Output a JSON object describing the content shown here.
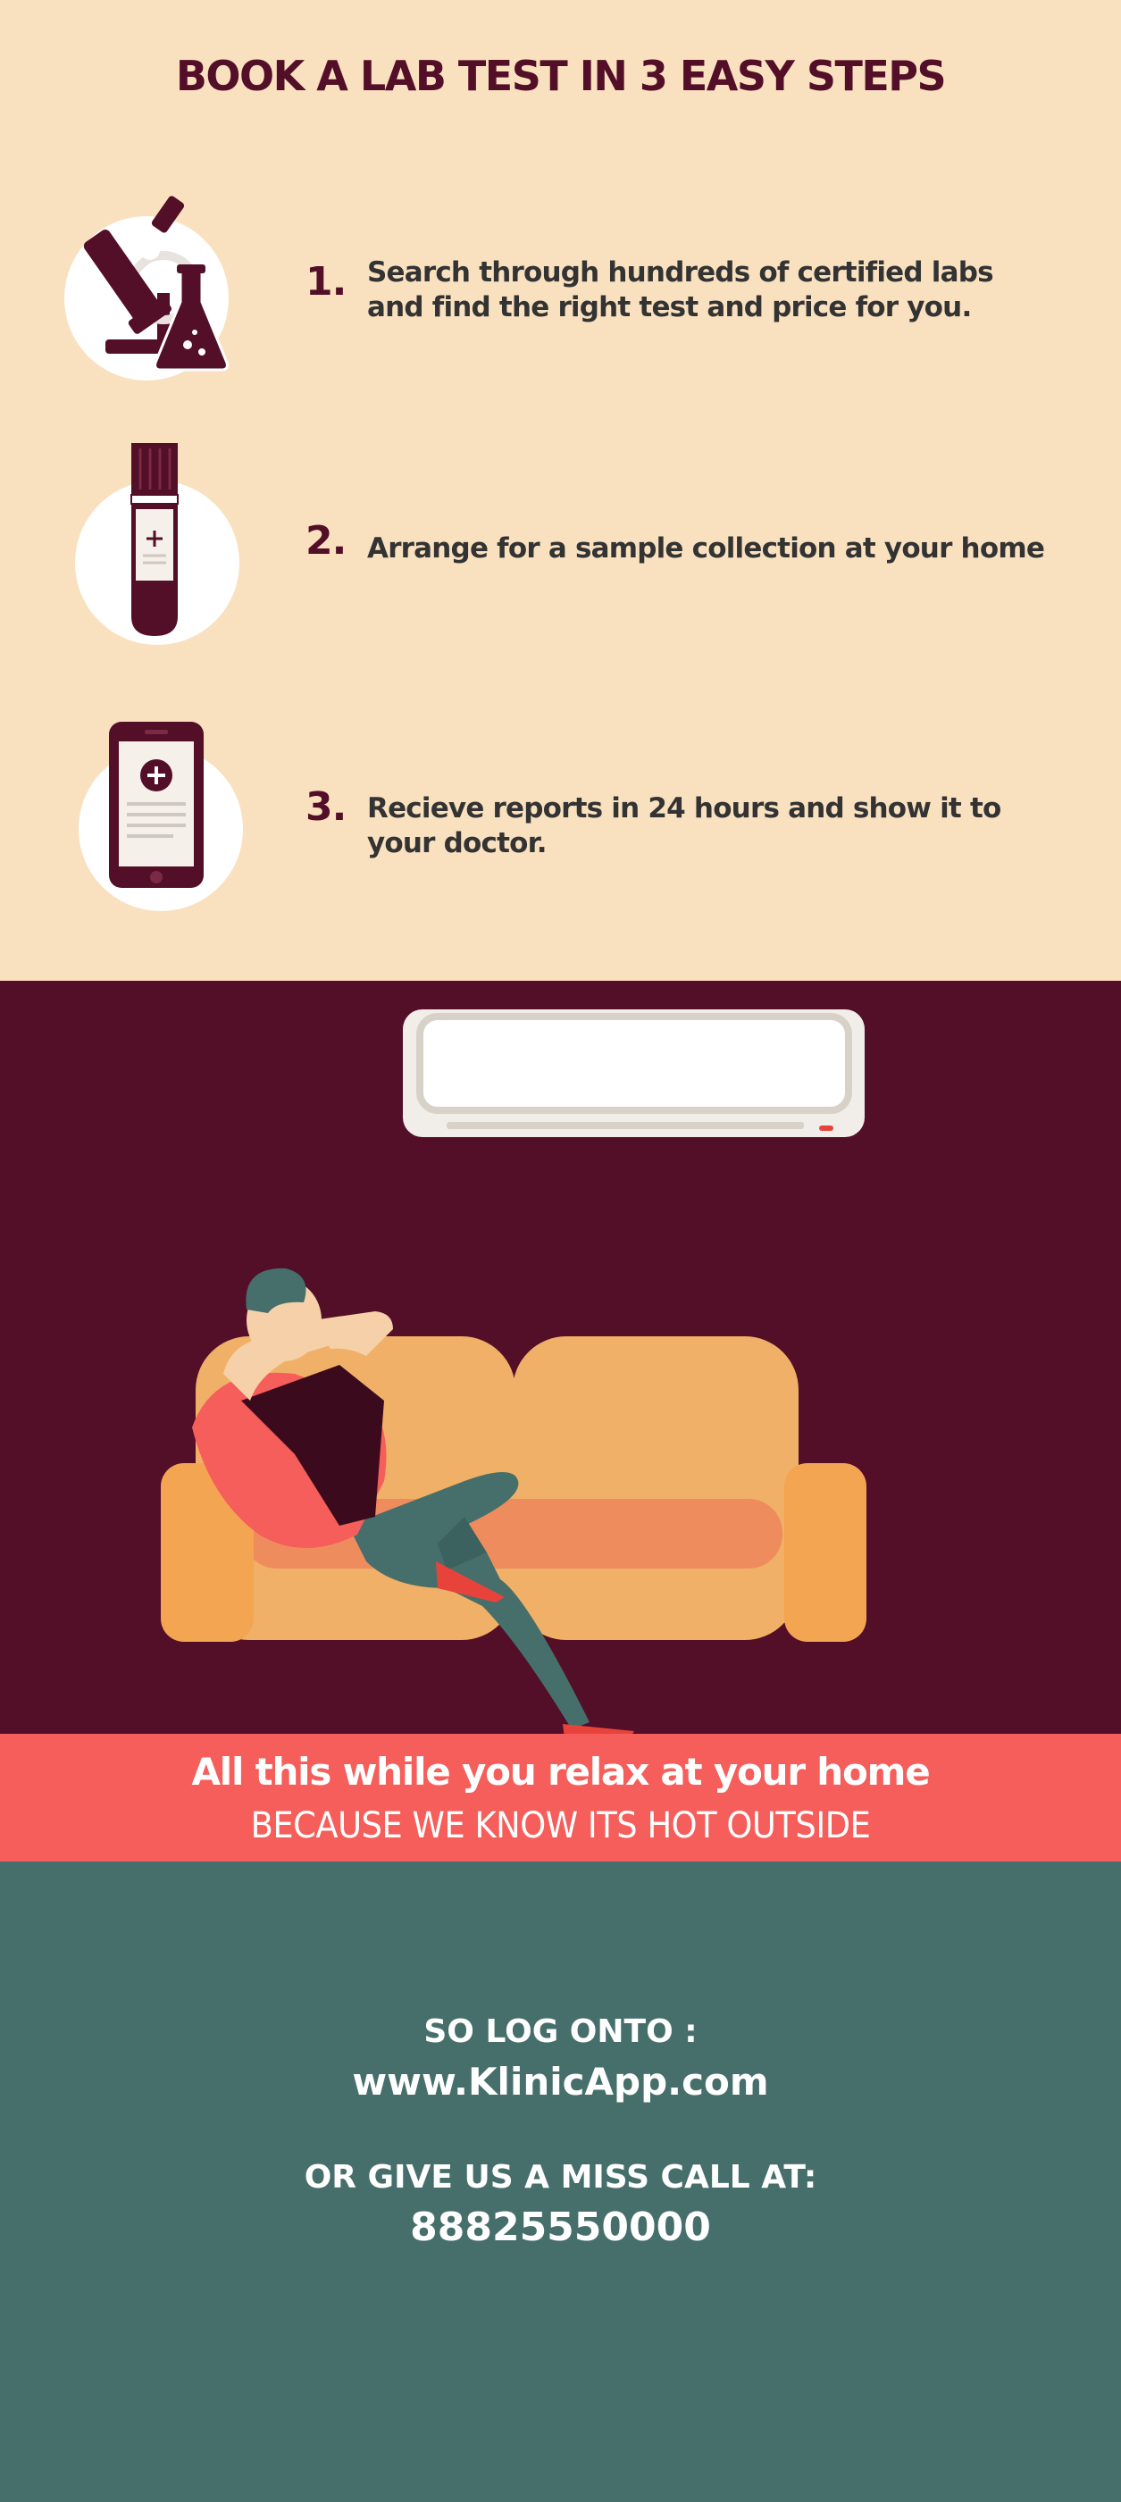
{
  "header": {
    "title": "BOOK A LAB TEST IN 3 EASY STEPS"
  },
  "steps": [
    {
      "number": "1.",
      "text": "Search through hundreds of certified labs and find the right test and price for you.",
      "icon": "microscope-flask-icon"
    },
    {
      "number": "2.",
      "text": "Arrange for a sample collection at your home",
      "icon": "test-tube-icon"
    },
    {
      "number": "3.",
      "text": "Recieve reports in 24 hours and show it to your doctor.",
      "icon": "smartphone-report-icon"
    }
  ],
  "illustration": {
    "scene": "man-relaxing-on-sofa-under-air-conditioner",
    "icons": [
      "air-conditioner-icon",
      "sofa-icon",
      "man-relaxing-icon"
    ]
  },
  "banner": {
    "line1": "All this while you relax at your home",
    "line2": "BECAUSE WE KNOW ITS HOT OUTSIDE"
  },
  "contact": {
    "login_label": "SO LOG ONTO :",
    "website": "www.KlinicApp.com",
    "call_label": "OR GIVE US A MISS CALL AT:",
    "phone": "88825550000"
  },
  "colors": {
    "cream": "#f9e1c0",
    "maroon": "#530e28",
    "coral": "#f55e5a",
    "teal": "#466f6b",
    "sofa": "#f0b067",
    "white": "#ffffff"
  }
}
